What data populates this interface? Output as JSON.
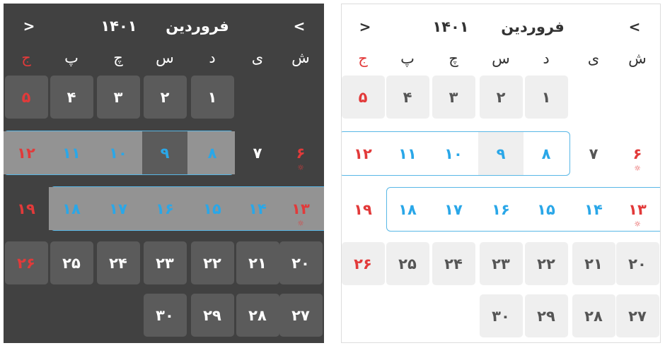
{
  "calendar": {
    "month": "فروردین",
    "year": "۱۴۰۱",
    "prev_label": "<",
    "next_label": ">",
    "weekdays": [
      "ش",
      "ی",
      "د",
      "س",
      "چ",
      "پ",
      "ج"
    ],
    "days": [
      "۱",
      "۲",
      "۳",
      "۴",
      "۵",
      "۶",
      "۷",
      "۸",
      "۹",
      "۱۰",
      "۱۱",
      "۱۲",
      "۱۳",
      "۱۴",
      "۱۵",
      "۱۶",
      "۱۷",
      "۱۸",
      "۱۹",
      "۲۰",
      "۲۱",
      "۲۲",
      "۲۳",
      "۲۴",
      "۲۵",
      "۲۶",
      "۲۷",
      "۲۸",
      "۲۹",
      "۳۰"
    ],
    "holiday_mark": "☼",
    "holiday_mark_days": [
      6,
      13
    ]
  },
  "colors": {
    "holiday": "#e23a3a",
    "selected": "#2aa7e8",
    "dark_background": "#414141",
    "dark_cell": "#5b5b5b",
    "dark_band": "#939393",
    "light_cell": "#efefef",
    "band_border": "#58b7e6"
  }
}
